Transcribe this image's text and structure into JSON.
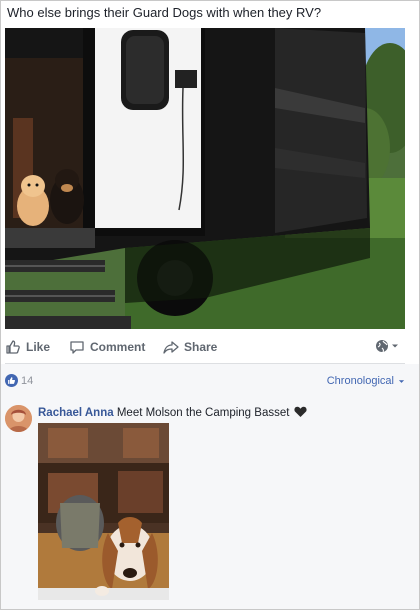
{
  "post": {
    "text": "Who else brings their Guard Dogs with when they RV?",
    "photo_alt": "Two small dogs on the step of an RV"
  },
  "actions": {
    "like": "Like",
    "comment": "Comment",
    "share": "Share"
  },
  "summary": {
    "like_count": "14",
    "sort_label": "Chronological"
  },
  "comment": {
    "author": "Rachael Anna",
    "text": "Meet Molson the Camping Basset",
    "photo_alt": "Basset hound inside an RV"
  },
  "colors": {
    "link": "#385898",
    "accent": "#4267b2",
    "muted": "#606770"
  }
}
